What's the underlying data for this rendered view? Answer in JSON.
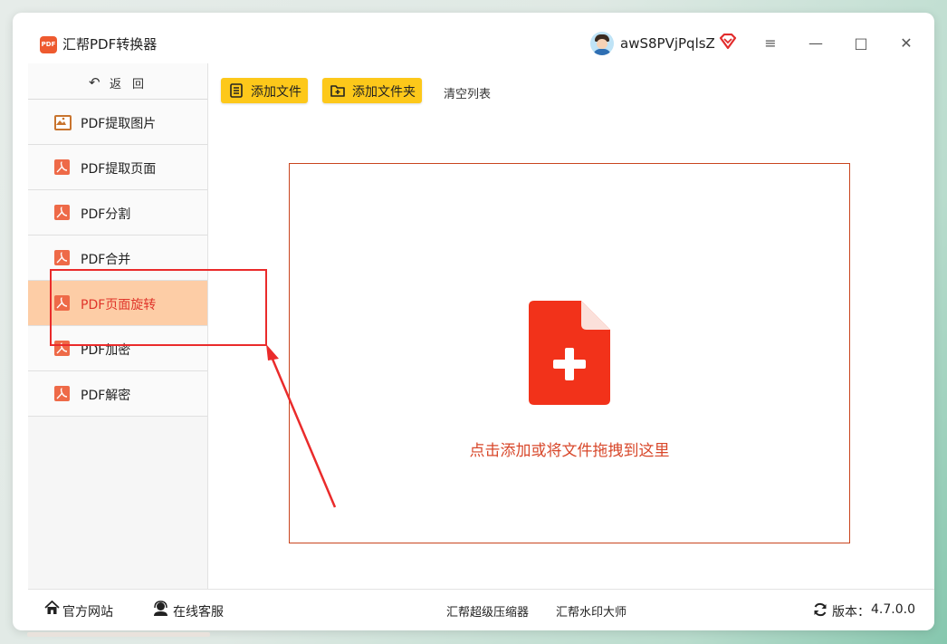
{
  "app": {
    "title": "汇帮PDF转换器",
    "logo_text": "PDF"
  },
  "user": {
    "name": "awS8PVjPqlsZ"
  },
  "window_controls": {
    "menu": "≡",
    "minimize": "—",
    "maximize": "□",
    "close": "✕"
  },
  "sidebar": {
    "back_label": "返回",
    "items": [
      {
        "label": "PDF提取图片",
        "icon": "image-icon"
      },
      {
        "label": "PDF提取页面",
        "icon": "pdf-icon"
      },
      {
        "label": "PDF分割",
        "icon": "pdf-icon"
      },
      {
        "label": "PDF合并",
        "icon": "pdf-icon"
      },
      {
        "label": "PDF页面旋转",
        "icon": "pdf-icon",
        "active": true
      },
      {
        "label": "PDF加密",
        "icon": "pdf-icon"
      },
      {
        "label": "PDF解密",
        "icon": "pdf-icon"
      }
    ]
  },
  "toolbar": {
    "add_file": "添加文件",
    "add_folder": "添加文件夹",
    "clear_list": "清空列表"
  },
  "dropzone": {
    "text": "点击添加或将文件拖拽到这里"
  },
  "footer": {
    "official_site": "官方网站",
    "online_service": "在线客服",
    "compressor": "汇帮超级压缩器",
    "watermark": "汇帮水印大师",
    "version_label": "版本：",
    "version": "4.7.0.0"
  },
  "colors": {
    "accent_yellow": "#fdc81a",
    "active_bg": "#fdcda6",
    "active_text": "#e0352a",
    "drop_icon": "#f2321a",
    "annotation_red": "#ea2b2b"
  }
}
